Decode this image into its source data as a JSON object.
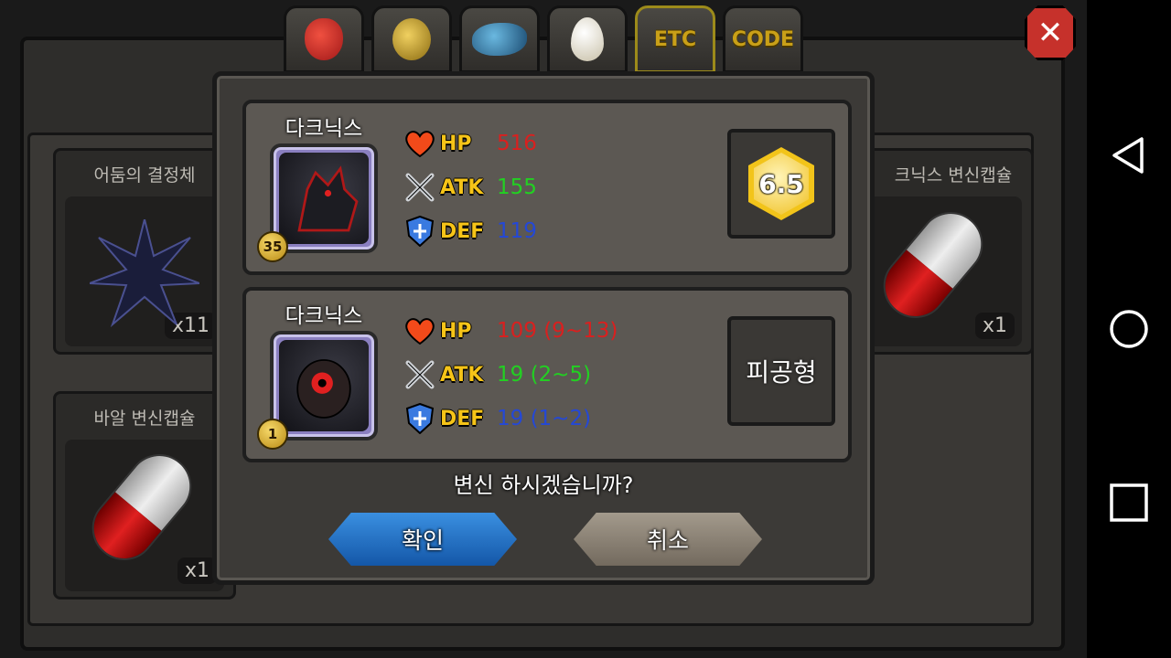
{
  "tabs": [
    {
      "name": "fruit",
      "label": ""
    },
    {
      "name": "gold",
      "label": ""
    },
    {
      "name": "fish",
      "label": ""
    },
    {
      "name": "egg",
      "label": ""
    },
    {
      "name": "etc",
      "label": "ETC"
    },
    {
      "name": "code",
      "label": "CODE"
    }
  ],
  "background_items": [
    {
      "name": "어둠의 결정체",
      "count": "x11"
    },
    {
      "name": "크닉스 변신캡슐",
      "count": "x1"
    },
    {
      "name": "바알 변신캡슐",
      "count": "x1"
    }
  ],
  "dialog": {
    "current": {
      "name": "다크닉스",
      "level": "35",
      "hp_label": "HP",
      "hp": "516",
      "atk_label": "ATK",
      "atk": "155",
      "def_label": "DEF",
      "def": "119",
      "grade": "6.5"
    },
    "result": {
      "name": "다크닉스",
      "level": "1",
      "hp_label": "HP",
      "hp": "109 (9~13)",
      "atk_label": "ATK",
      "atk": "19 (2~5)",
      "def_label": "DEF",
      "def": "19 (1~2)",
      "type": "피공형"
    },
    "question": "변신 하시겠습니까?",
    "confirm_label": "확인",
    "cancel_label": "취소"
  },
  "colors": {
    "hp": "#d9201f",
    "atk": "#22d022",
    "def": "#2448d6",
    "stat_label": "#f6c418"
  },
  "icons": {
    "close": "close-icon",
    "hp": "heart-icon",
    "atk": "crossed-swords-icon",
    "def": "shield-icon",
    "nav_back": "back-triangle-icon",
    "nav_home": "home-circle-icon",
    "nav_recent": "recent-square-icon"
  }
}
